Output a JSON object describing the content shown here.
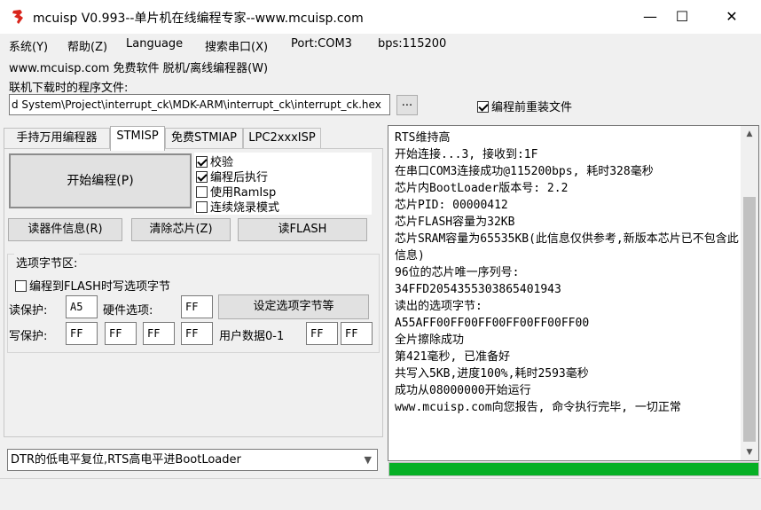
{
  "window": {
    "title": "mcuisp V0.993--单片机在线编程专家--www.mcuisp.com",
    "minimize": "—",
    "maximize": "☐",
    "close": "✕"
  },
  "menu": {
    "items": [
      "系统(Y)",
      "帮助(Z)",
      "Language",
      "搜索串口(X)",
      "Port:COM3",
      "bps:115200"
    ],
    "line2": "www.mcuisp.com 免费软件 脱机/离线编程器(W)"
  },
  "file": {
    "label": "联机下载时的程序文件:",
    "path": "d System\\Project\\interrupt_ck\\MDK-ARM\\interrupt_ck\\interrupt_ck.hex",
    "browse": "...",
    "reload_label": "编程前重装文件",
    "reload_checked": true
  },
  "tabs": [
    "手持万用编程器",
    "STMISP",
    "免费STMIAP",
    "LPC2xxxISP"
  ],
  "stmisp": {
    "start_button": "开始编程(P)",
    "options": [
      {
        "label": "校验",
        "checked": true
      },
      {
        "label": "编程后执行",
        "checked": true
      },
      {
        "label": "使用RamIsp",
        "checked": false
      },
      {
        "label": "连续烧录模式",
        "checked": false
      }
    ],
    "read_info_button": "读器件信息(R)",
    "erase_button": "清除芯片(Z)",
    "read_flash_button": "读FLASH",
    "option_bytes": {
      "legend": "选项字节区:",
      "program_label": "编程到FLASH时写选项字节",
      "program_checked": false,
      "read_protect_label": "读保护:",
      "read_protect_value": "A5",
      "hw_option_label": "硬件选项:",
      "hw_option_value": "FF",
      "set_button": "设定选项字节等",
      "write_protect_label": "写保护:",
      "write_protect_values": [
        "FF",
        "FF",
        "FF",
        "FF"
      ],
      "user_data_label": "用户数据0-1",
      "user_data_values": [
        "FF",
        "FF"
      ]
    },
    "reset_mode": "DTR的低电平复位,RTS高电平进BootLoader"
  },
  "log": {
    "lines": [
      "RTS维持高",
      "开始连接...3, 接收到:1F",
      "在串口COM3连接成功@115200bps, 耗时328毫秒",
      "芯片内BootLoader版本号: 2.2",
      "芯片PID: 00000412",
      "芯片FLASH容量为32KB",
      "芯片SRAM容量为65535KB(此信息仅供参考,新版本芯片已不包含此信息)",
      "96位的芯片唯一序列号:",
      "34FFD2054355303865401943",
      "读出的选项字节:",
      "A55AFF00FF00FF00FF00FF00FF00",
      "全片擦除成功",
      "第421毫秒, 已准备好",
      "共写入5KB,进度100%,耗时2593毫秒",
      "成功从08000000开始运行",
      "www.mcuisp.com向您报告, 命令执行完毕, 一切正常"
    ]
  },
  "progress": {
    "value": 1.0,
    "color": "#06b025"
  },
  "icons": {
    "app": "mcuisp-logo-icon",
    "browse": "ellipsis",
    "dropdown": "chevron-down-icon"
  }
}
